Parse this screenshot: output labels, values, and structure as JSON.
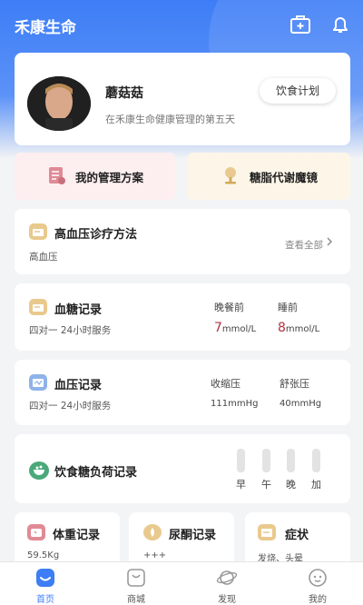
{
  "header": {
    "title": "禾康生命",
    "icons": [
      "medical-kit-icon",
      "bell-icon"
    ]
  },
  "profile": {
    "name": "蘑菇菇",
    "description": "在禾康生命健康管理的第五天",
    "diet_button": "饮食计划"
  },
  "quick_actions": [
    {
      "label": "我的管理方案",
      "icon": "plan-icon",
      "bg": "#fdeef0"
    },
    {
      "label": "糖脂代谢魔镜",
      "icon": "mirror-icon",
      "bg": "#fdf6e8"
    }
  ],
  "hypertension": {
    "title": "高血压诊疗方法",
    "subtitle": "高血压",
    "see_all": "查看全部"
  },
  "blood_sugar": {
    "title": "血糖记录",
    "subtitle": "四对一 24小时服务",
    "col1_label": "晚餐前",
    "col1_value": "7",
    "col1_unit": "mmol/L",
    "col2_label": "睡前",
    "col2_value": "8",
    "col2_unit": "mmol/L"
  },
  "blood_pressure": {
    "title": "血压记录",
    "subtitle": "四对一 24小时服务",
    "col1_label": "收缩压",
    "col1_value": "111mmHg",
    "col2_label": "舒张压",
    "col2_value": "40mmHg"
  },
  "diet_load": {
    "title": "饮食糖负荷记录",
    "meals": [
      "早",
      "午",
      "晚",
      "加"
    ]
  },
  "mini_cards": [
    {
      "title": "体重记录",
      "value": "59.5Kg"
    },
    {
      "title": "尿酮记录",
      "value": "+++"
    },
    {
      "title": "症状",
      "value": "发烧、头晕"
    }
  ],
  "tabs": [
    {
      "label": "首页",
      "active": true
    },
    {
      "label": "商城",
      "active": false
    },
    {
      "label": "发现",
      "active": false
    },
    {
      "label": "我的",
      "active": false
    }
  ],
  "colors": {
    "primary": "#3d7df6",
    "accent_red": "#b23340",
    "icon_yellow": "#e9c98d",
    "icon_blue": "#8fb3e8",
    "icon_green": "#4aa97a",
    "icon_pink": "#e08a95"
  }
}
